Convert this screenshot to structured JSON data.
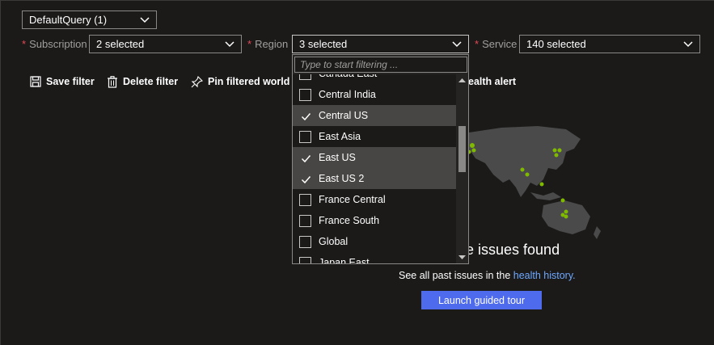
{
  "query_select": {
    "value": "DefaultQuery (1)",
    "icon": "chevron-down-icon"
  },
  "filters": {
    "subscription": {
      "label": "Subscription",
      "value": "2 selected"
    },
    "region": {
      "label": "Region",
      "value": "3 selected"
    },
    "service": {
      "label": "Service",
      "value": "140 selected"
    },
    "required_marker": "*"
  },
  "toolbar": {
    "save_label": "Save filter",
    "delete_label": "Delete filter",
    "pin_label": "Pin filtered world m",
    "alert_label": "ealth alert"
  },
  "region_dropdown": {
    "filter_placeholder": "Type to start filtering ...",
    "options": [
      {
        "label": "Canada East",
        "selected": false
      },
      {
        "label": "Central India",
        "selected": false
      },
      {
        "label": "Central US",
        "selected": true
      },
      {
        "label": "East Asia",
        "selected": false
      },
      {
        "label": "East US",
        "selected": true
      },
      {
        "label": "East US 2",
        "selected": true
      },
      {
        "label": "France Central",
        "selected": false
      },
      {
        "label": "France South",
        "selected": false
      },
      {
        "label": "Global",
        "selected": false
      },
      {
        "label": "Japan East",
        "selected": false
      }
    ]
  },
  "empty_state": {
    "title": "e issues found",
    "history_prefix": "See all past issues in the ",
    "history_link": "health history.",
    "tour_button": "Launch guided tour"
  },
  "colors": {
    "background": "#1b1a19",
    "accent": "#4f6bed",
    "link": "#6ea8ff",
    "required": "#e74856",
    "map_dot": "#7fba00"
  }
}
